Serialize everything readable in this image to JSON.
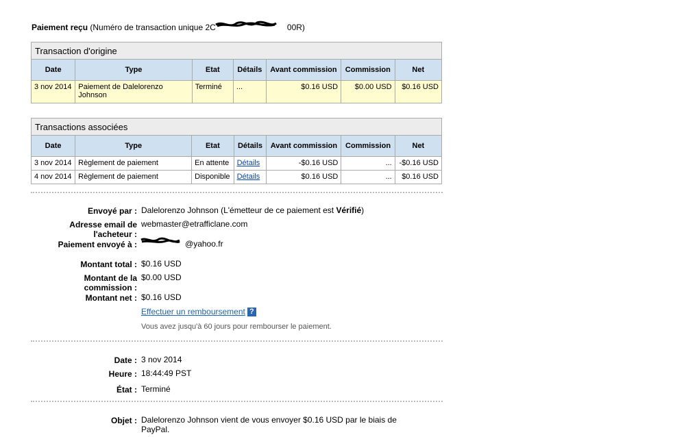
{
  "header": {
    "title_bold": "Paiement reçu",
    "title_rest_prefix": "(Numéro de transaction unique 2C",
    "title_rest_suffix": "00R)"
  },
  "origin_table": {
    "caption": "Transaction d'origine",
    "columns": [
      "Date",
      "Type",
      "Etat",
      "Détails",
      "Avant commission",
      "Commission",
      "Net"
    ],
    "rows": [
      {
        "date": "3 nov 2014",
        "type": "Paiement de Dalelorenzo Johnson",
        "etat": "Terminé",
        "details": "...",
        "avant": "$0.16 USD",
        "commission": "$0.00 USD",
        "net": "$0.16 USD"
      }
    ]
  },
  "related_table": {
    "caption": "Transactions associées",
    "columns": [
      "Date",
      "Type",
      "Etat",
      "Détails",
      "Avant commission",
      "Commission",
      "Net"
    ],
    "rows": [
      {
        "date": "3 nov 2014",
        "type": "Règlement de paiement",
        "etat": "En attente",
        "details": "Détails",
        "avant": "-$0.16 USD",
        "commission": "...",
        "net": "-$0.16 USD"
      },
      {
        "date": "4 nov 2014",
        "type": "Règlement de paiement",
        "etat": "Disponible",
        "details": "Détails",
        "avant": "$0.16 USD",
        "commission": "...",
        "net": "$0.16 USD"
      }
    ]
  },
  "details": {
    "sent_by_label": "Envoyé par :",
    "sent_by_value": "Dalelorenzo Johnson (L'émetteur de ce paiement est ",
    "sent_by_status": "Vérifié",
    "sent_by_close": ")",
    "email_label_1": "Adresse email de",
    "email_label_2": "l'acheteur :",
    "email_value": "webmaster@etrafficlane.com",
    "sent_to_label": "Paiement envoyé à :",
    "sent_to_value": "@yahoo.fr",
    "total_label": "Montant total :",
    "total_value": "$0.16 USD",
    "fee_label_1": "Montant de la",
    "fee_label_2": "commission :",
    "fee_value": "$0.00 USD",
    "net_label": "Montant net :",
    "net_value": "$0.16 USD",
    "refund_link": "Effectuer un remboursement",
    "help_glyph": "?",
    "refund_note": "Vous avez jusqu'à 60 jours pour rembourser le paiement."
  },
  "time": {
    "date_label": "Date :",
    "date_value": "3 nov 2014",
    "hour_label": "Heure :",
    "hour_value": "18:44:49 PST",
    "state_label": "État :",
    "state_value": "Terminé"
  },
  "object": {
    "label": "Objet :",
    "value_line1": "Dalelorenzo Johnson vient de vous envoyer $0.16 USD par le biais de",
    "value_line2": "PayPal."
  }
}
